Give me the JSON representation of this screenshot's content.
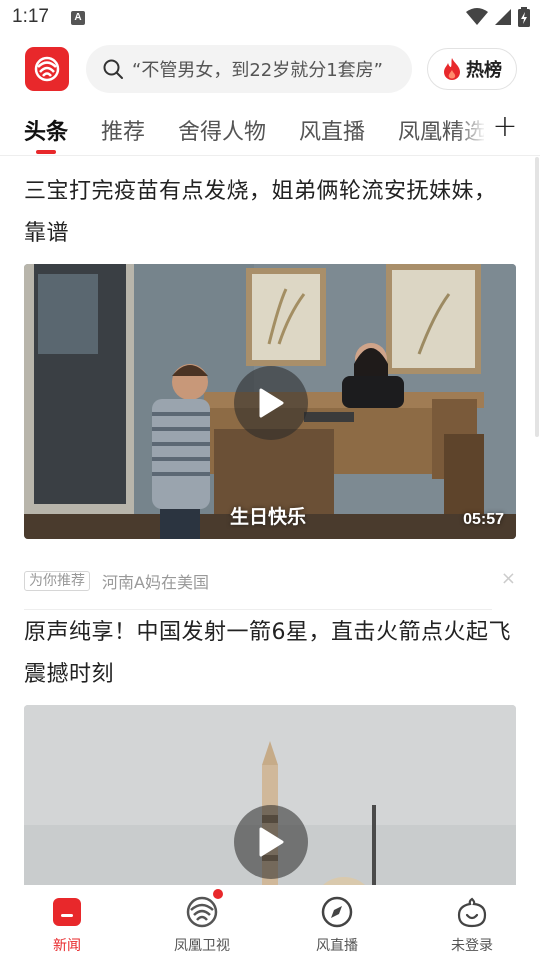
{
  "status_bar": {
    "time": "1:17",
    "notification_letter": "A"
  },
  "header": {
    "logo_icon": "phoenix-logo-icon",
    "search_placeholder": "“不管男女，到22岁就分1套房”",
    "hot_label": "热榜"
  },
  "tabs": {
    "items": [
      {
        "label": "头条",
        "active": true
      },
      {
        "label": "推荐",
        "active": false
      },
      {
        "label": "舍得人物",
        "active": false
      },
      {
        "label": "风直播",
        "active": false
      },
      {
        "label": "凤凰精选",
        "active": false
      }
    ],
    "add_label": "+"
  },
  "feed": {
    "articles": [
      {
        "title": "三宝打完疫苗有点发烧，姐弟俩轮流安抚妹妹，靠谱",
        "video_caption": "生日快乐",
        "duration": "05:57",
        "badge": "为你推荐",
        "source": "河南A妈在美国",
        "close": "×"
      },
      {
        "title": "原声纯享！中国发射一箭6星，直击火箭点火起飞震撼时刻"
      }
    ]
  },
  "bottom_nav": [
    {
      "label": "新闻",
      "icon": "news-icon",
      "active": true
    },
    {
      "label": "凤凰卫视",
      "icon": "phoenix-tv-icon",
      "active": false
    },
    {
      "label": "风直播",
      "icon": "compass-icon",
      "active": false
    },
    {
      "label": "未登录",
      "icon": "user-icon",
      "active": false
    }
  ],
  "colors": {
    "brand": "#e8282b",
    "text": "#222222",
    "muted": "#999999"
  }
}
